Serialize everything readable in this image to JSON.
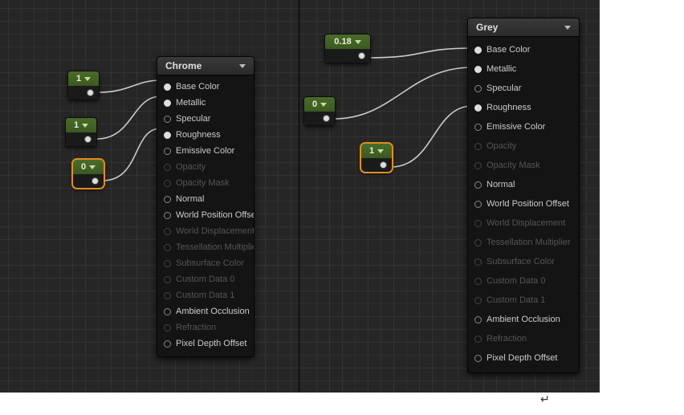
{
  "left_graph": {
    "material": {
      "title": "Chrome",
      "inputs": [
        {
          "label": "Base Color",
          "enabled": true,
          "connected": true
        },
        {
          "label": "Metallic",
          "enabled": true,
          "connected": true
        },
        {
          "label": "Specular",
          "enabled": true,
          "connected": false
        },
        {
          "label": "Roughness",
          "enabled": true,
          "connected": true
        },
        {
          "label": "Emissive Color",
          "enabled": true,
          "connected": false
        },
        {
          "label": "Opacity",
          "enabled": false,
          "connected": false
        },
        {
          "label": "Opacity Mask",
          "enabled": false,
          "connected": false
        },
        {
          "label": "Normal",
          "enabled": true,
          "connected": false
        },
        {
          "label": "World Position Offset",
          "enabled": true,
          "connected": false
        },
        {
          "label": "World Displacement",
          "enabled": false,
          "connected": false
        },
        {
          "label": "Tessellation Multiplier",
          "enabled": false,
          "connected": false
        },
        {
          "label": "Subsurface Color",
          "enabled": false,
          "connected": false
        },
        {
          "label": "Custom Data 0",
          "enabled": false,
          "connected": false
        },
        {
          "label": "Custom Data 1",
          "enabled": false,
          "connected": false
        },
        {
          "label": "Ambient Occlusion",
          "enabled": true,
          "connected": false
        },
        {
          "label": "Refraction",
          "enabled": false,
          "connected": false
        },
        {
          "label": "Pixel Depth Offset",
          "enabled": true,
          "connected": false
        }
      ]
    },
    "constants": [
      {
        "id": "c1",
        "value": "1",
        "selected": false
      },
      {
        "id": "c2",
        "value": "1",
        "selected": false
      },
      {
        "id": "c3",
        "value": "0",
        "selected": true
      }
    ]
  },
  "right_graph": {
    "material": {
      "title": "Grey",
      "inputs": [
        {
          "label": "Base Color",
          "enabled": true,
          "connected": true
        },
        {
          "label": "Metallic",
          "enabled": true,
          "connected": true
        },
        {
          "label": "Specular",
          "enabled": true,
          "connected": false
        },
        {
          "label": "Roughness",
          "enabled": true,
          "connected": true
        },
        {
          "label": "Emissive Color",
          "enabled": true,
          "connected": false
        },
        {
          "label": "Opacity",
          "enabled": false,
          "connected": false
        },
        {
          "label": "Opacity Mask",
          "enabled": false,
          "connected": false
        },
        {
          "label": "Normal",
          "enabled": true,
          "connected": false
        },
        {
          "label": "World Position Offset",
          "enabled": true,
          "connected": false
        },
        {
          "label": "World Displacement",
          "enabled": false,
          "connected": false
        },
        {
          "label": "Tessellation Multiplier",
          "enabled": false,
          "connected": false
        },
        {
          "label": "Subsurface Color",
          "enabled": false,
          "connected": false
        },
        {
          "label": "Custom Data 0",
          "enabled": false,
          "connected": false
        },
        {
          "label": "Custom Data 1",
          "enabled": false,
          "connected": false
        },
        {
          "label": "Ambient Occlusion",
          "enabled": true,
          "connected": false
        },
        {
          "label": "Refraction",
          "enabled": false,
          "connected": false
        },
        {
          "label": "Pixel Depth Offset",
          "enabled": true,
          "connected": false
        }
      ]
    },
    "constants": [
      {
        "id": "r1",
        "value": "0.18",
        "selected": false
      },
      {
        "id": "r2",
        "value": "0",
        "selected": false
      },
      {
        "id": "r3",
        "value": "1",
        "selected": true
      }
    ]
  }
}
